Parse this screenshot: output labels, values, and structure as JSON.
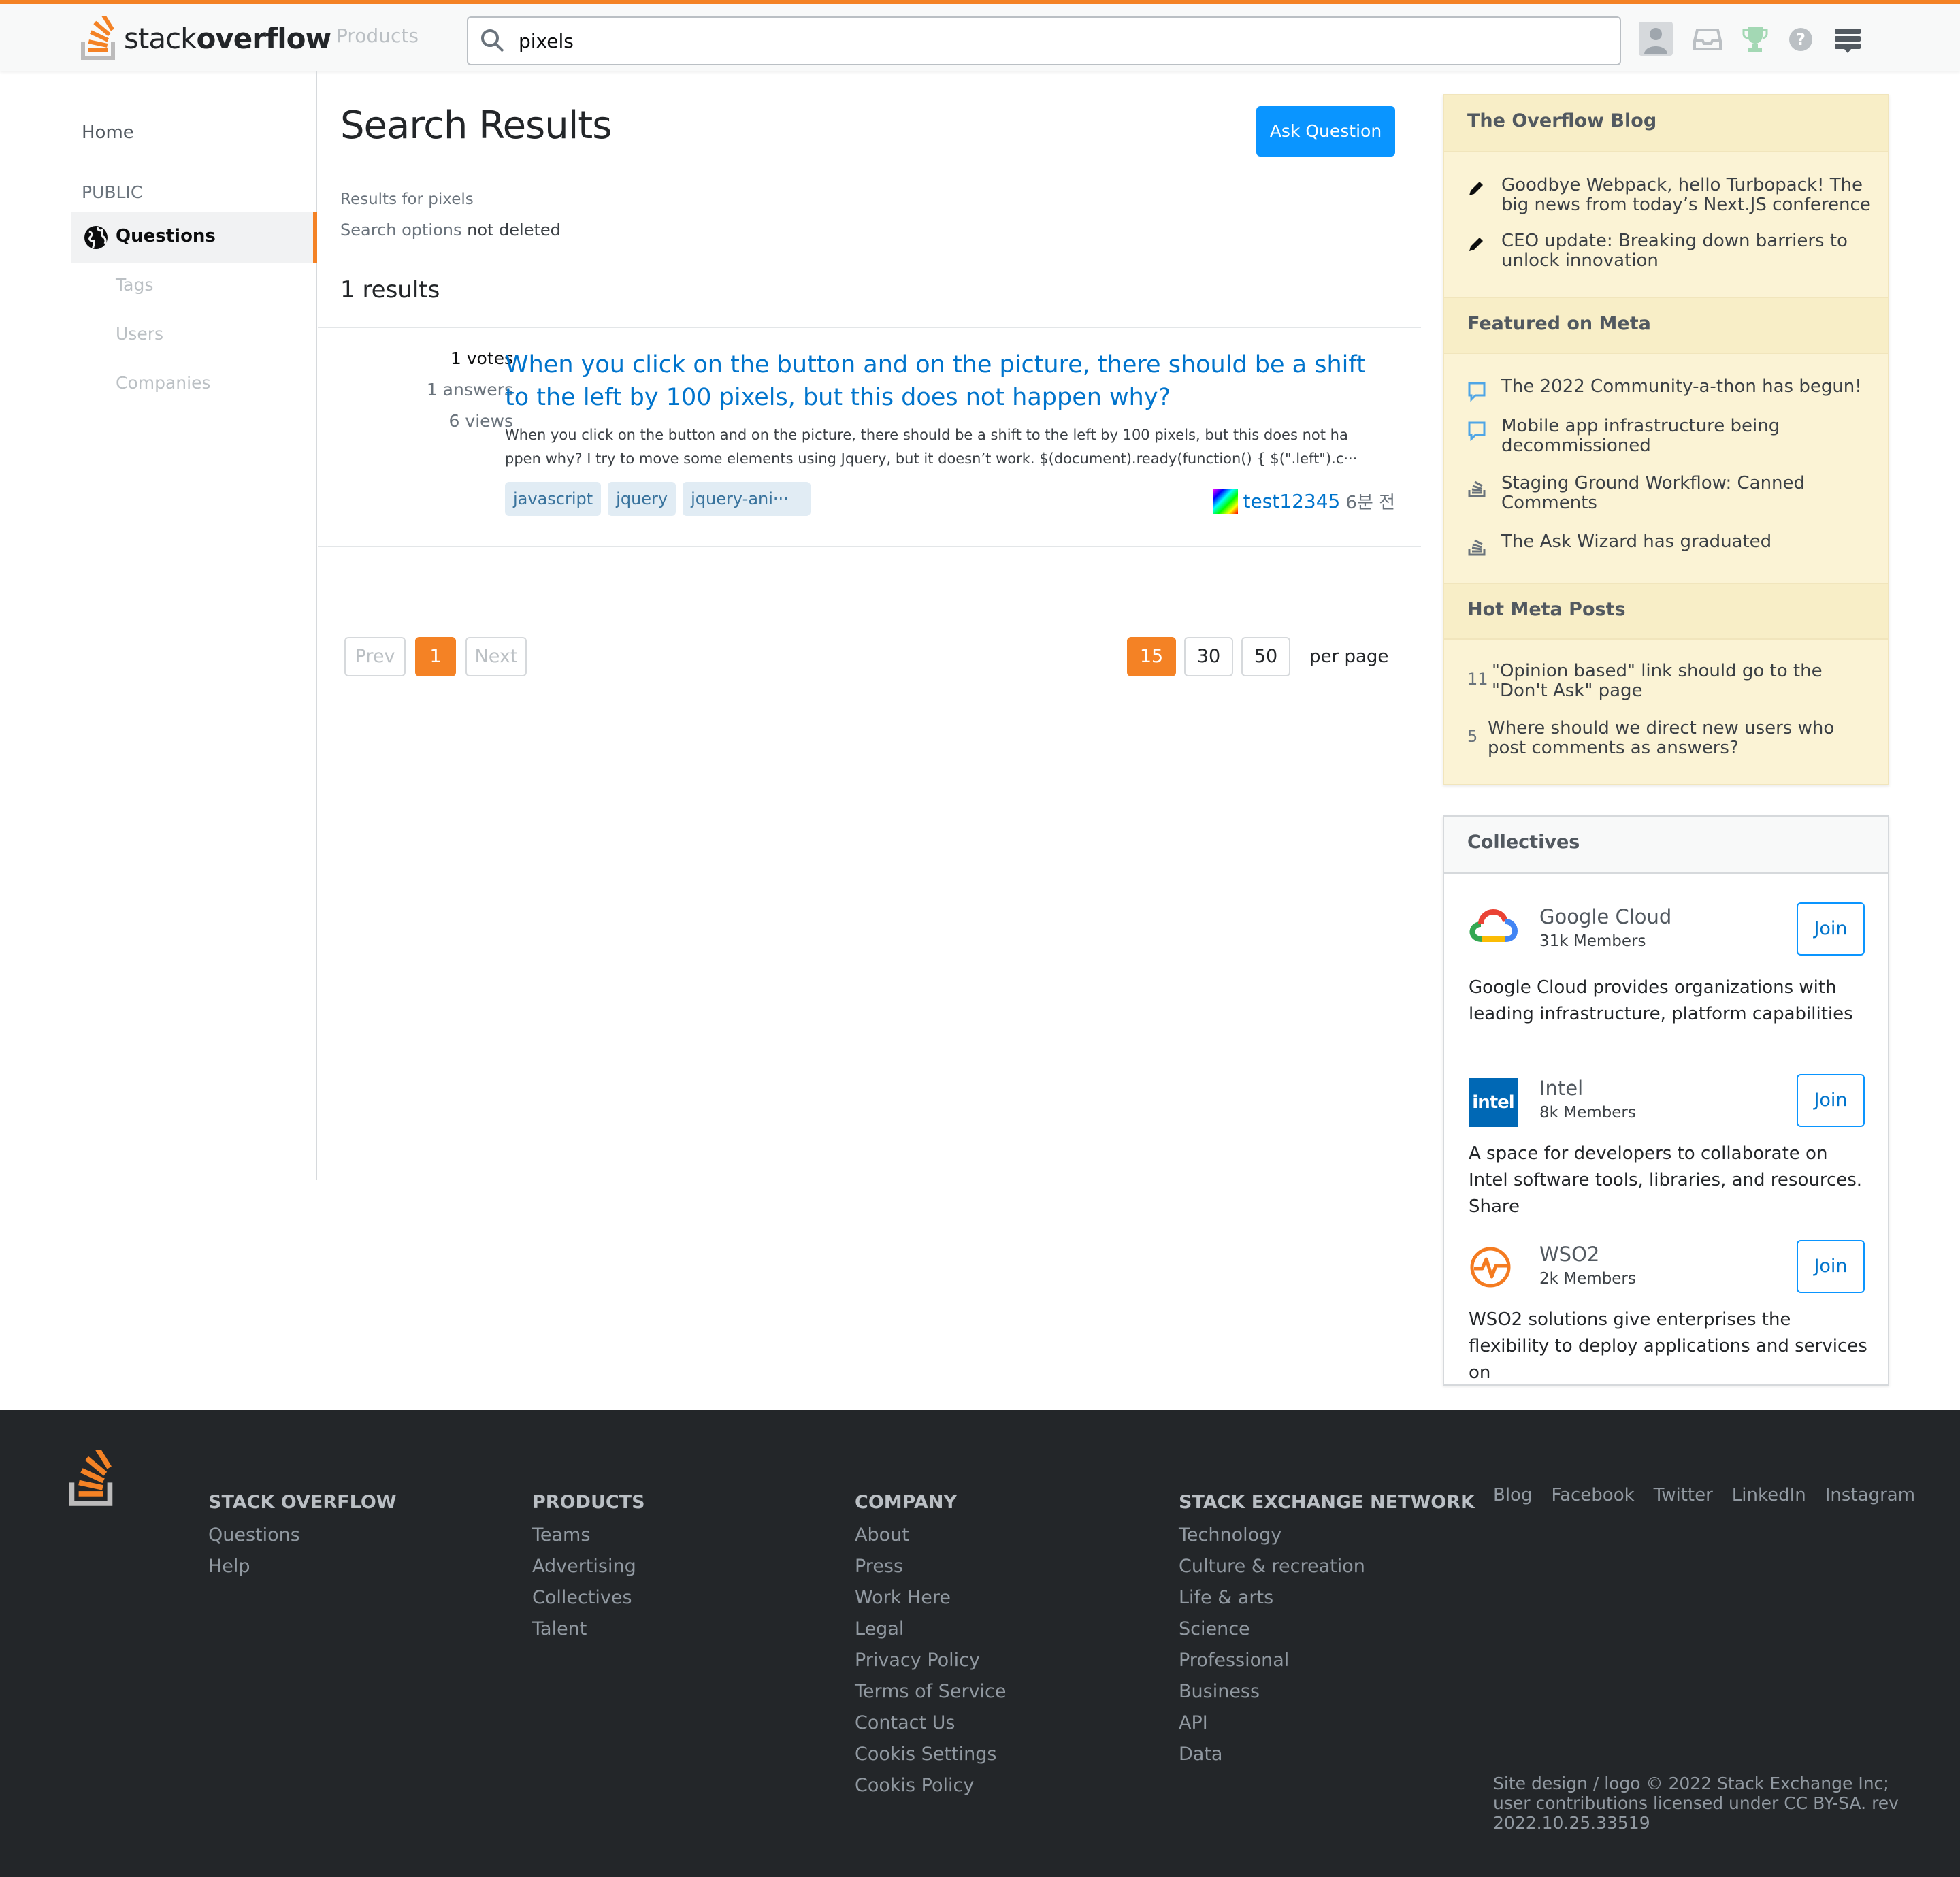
{
  "header": {
    "logo_light": "stack",
    "logo_bold": "overflow",
    "products": "Products",
    "search_value": "pixels"
  },
  "sidebar": {
    "home": "Home",
    "public": "PUBLIC",
    "questions": "Questions",
    "tags": "Tags",
    "users": "Users",
    "companies": "Companies"
  },
  "main": {
    "title": "Search Results",
    "ask_button": "Ask Question",
    "results_for": "Results for pixels",
    "search_options_label": "Search options",
    "search_options_value": "not deleted",
    "result_count": "1 results",
    "result": {
      "votes": "1 votes",
      "answers": "1 answers",
      "views": "6 views",
      "title": "When you click on the button and on the picture, there should be a shift to the left by 100 pixels, but this does not happen why?",
      "excerpt_line1": "When you click on the button and on the picture, there should be a shift to the left by 100 pixels, but this does not ha",
      "excerpt_line2": "ppen why? I try to move some elements using Jquery, but it doesn’t work. $(document).ready(function() { $(\".left\").c···",
      "tags": [
        "javascript",
        "jquery",
        "jquery-ani···"
      ],
      "user": "test12345",
      "time": "6분 전"
    },
    "pagination": {
      "prev": "Prev",
      "current": "1",
      "next": "Next",
      "sizes": [
        "15",
        "30",
        "50"
      ],
      "per_page": "per page"
    }
  },
  "blog": {
    "heading": "The Overflow Blog",
    "items": [
      "Goodbye Webpack, hello Turbopack! The big news from today’s Next.JS conference",
      "CEO update: Breaking down barriers to unlock innovation"
    ],
    "meta_heading": "Featured on Meta",
    "meta_items": [
      "The 2022 Community-a-thon has begun!",
      "Mobile app infrastructure being decommissioned",
      "Staging Ground Workflow: Canned Comments",
      "The Ask Wizard has graduated"
    ],
    "hot_heading": "Hot Meta Posts",
    "hot_items": [
      {
        "count": "11",
        "text": "\"Opinion based\" link should go to the \"Don't Ask\" page"
      },
      {
        "count": "5",
        "text": "Where should we direct new users who post comments as answers?"
      }
    ]
  },
  "collectives": {
    "heading": "Collectives",
    "join": "Join",
    "items": [
      {
        "name": "Google Cloud",
        "members": "31k Members",
        "desc": "Google Cloud provides organizations with leading infrastructure, platform capabilities"
      },
      {
        "name": "Intel",
        "members": "8k Members",
        "desc": "A space for developers to collaborate on Intel software tools, libraries, and resources. Share"
      },
      {
        "name": "WSO2",
        "members": "2k Members",
        "desc": "WSO2 solutions give enterprises the flexibility to deploy applications and services on"
      }
    ],
    "intel_logo_text": "intel"
  },
  "footer": {
    "cols": [
      {
        "heading": "STACK OVERFLOW",
        "links": [
          "Questions",
          "Help"
        ]
      },
      {
        "heading": "PRODUCTS",
        "links": [
          "Teams",
          "Advertising",
          "Collectives",
          "Talent"
        ]
      },
      {
        "heading": "COMPANY",
        "links": [
          "About",
          "Press",
          "Work Here",
          "Legal",
          "Privacy Policy",
          "Terms of Service",
          "Contact Us",
          "Cookis Settings",
          "Cookis Policy"
        ]
      },
      {
        "heading": "STACK EXCHANGE NETWORK",
        "links": [
          "Technology",
          "Culture & recreation",
          "Life & arts",
          "Science",
          "Professional",
          "Business",
          "API",
          "Data"
        ]
      }
    ],
    "social": [
      "Blog",
      "Facebook",
      "Twitter",
      "LinkedIn",
      "Instagram"
    ],
    "copyright": "Site design / logo © 2022 Stack Exchange Inc; user contributions licensed under CC BY-SA. rev 2022.10.25.33519"
  },
  "colors": {
    "accent": "#f48225",
    "link": "#0074cc",
    "button": "#0a95ff",
    "footer_bg": "#232629"
  }
}
